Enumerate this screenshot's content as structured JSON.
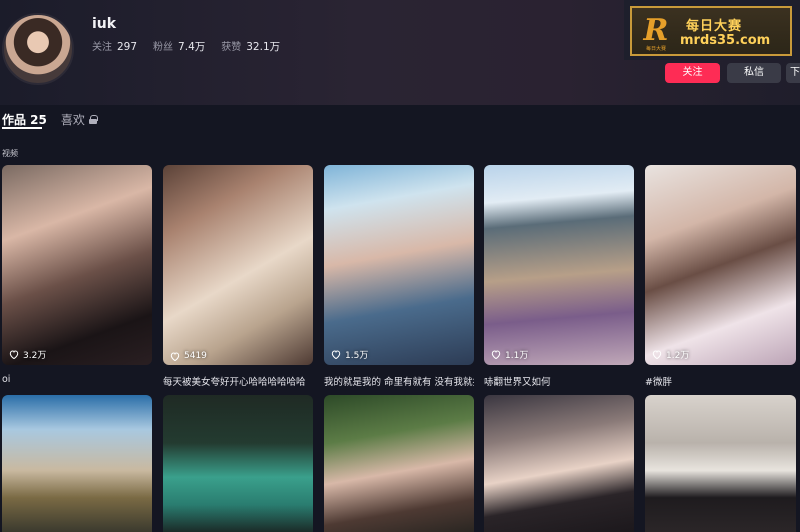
{
  "profile": {
    "username": "iuk",
    "stats": [
      {
        "label": "关注",
        "value": "297"
      },
      {
        "label": "粉丝",
        "value": "7.4万"
      },
      {
        "label": "获赞",
        "value": "32.1万"
      }
    ]
  },
  "ad": {
    "logo_letter": "R",
    "logo_sub": "每日大赛",
    "title": "每日大赛",
    "url": "mrds35.com"
  },
  "actions": {
    "follow_label": "关注",
    "message_label": "私信",
    "more_label": "下"
  },
  "tabs": [
    {
      "label": "作品 25",
      "active": true
    },
    {
      "label": "喜欢",
      "active": false,
      "locked": true
    }
  ],
  "section_label": "视频",
  "videos": [
    {
      "likes": "3.2万",
      "caption": "oi"
    },
    {
      "likes": "5419",
      "caption": "每天被美女夸好开心哈哈哈哈哈哈"
    },
    {
      "likes": "1.5万",
      "caption": "我的就是我的 命里有就有 没有我就抢"
    },
    {
      "likes": "1.1万",
      "caption": "哧翻世界又如何"
    },
    {
      "likes": "1.2万",
      "caption": "#微胖"
    },
    {
      "likes": "",
      "caption": ""
    },
    {
      "likes": "",
      "caption": ""
    },
    {
      "likes": "",
      "caption": ""
    },
    {
      "likes": "",
      "caption": ""
    },
    {
      "likes": "",
      "caption": ""
    }
  ],
  "colors": {
    "background": "#141622",
    "accent": "#fe2c55",
    "button_secondary": "#3a3b47",
    "ad_gold": "#ffd15a"
  }
}
